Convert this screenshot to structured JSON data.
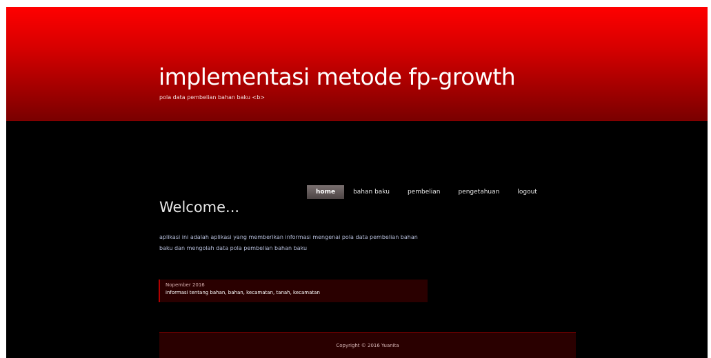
{
  "header": {
    "title": "implementasi metode fp-growth",
    "tagline": "pola data pembelian bahan baku <b>"
  },
  "nav": {
    "items": [
      {
        "label": "home",
        "active": true
      },
      {
        "label": "bahan baku",
        "active": false
      },
      {
        "label": "pembelian",
        "active": false
      },
      {
        "label": "pengetahuan",
        "active": false
      },
      {
        "label": "logout",
        "active": false
      }
    ]
  },
  "content": {
    "title": "Welcome...",
    "body": "aplikasi ini adalah aplikasi yang memberikan informasi mengenai pola data pembelian bahan baku dan mengolah data pola pembelian bahan baku"
  },
  "news": {
    "date": "Nopember 2016",
    "text": "informasi tentang bahan, bahan, kecamatan, tanah, kecamatan"
  },
  "footer": {
    "text": "Copyright © 2016 Yuanita"
  },
  "colors": {
    "header_top": "#ff0000",
    "header_bottom": "#7a0000",
    "background": "#000000",
    "box": "#2a0000"
  }
}
